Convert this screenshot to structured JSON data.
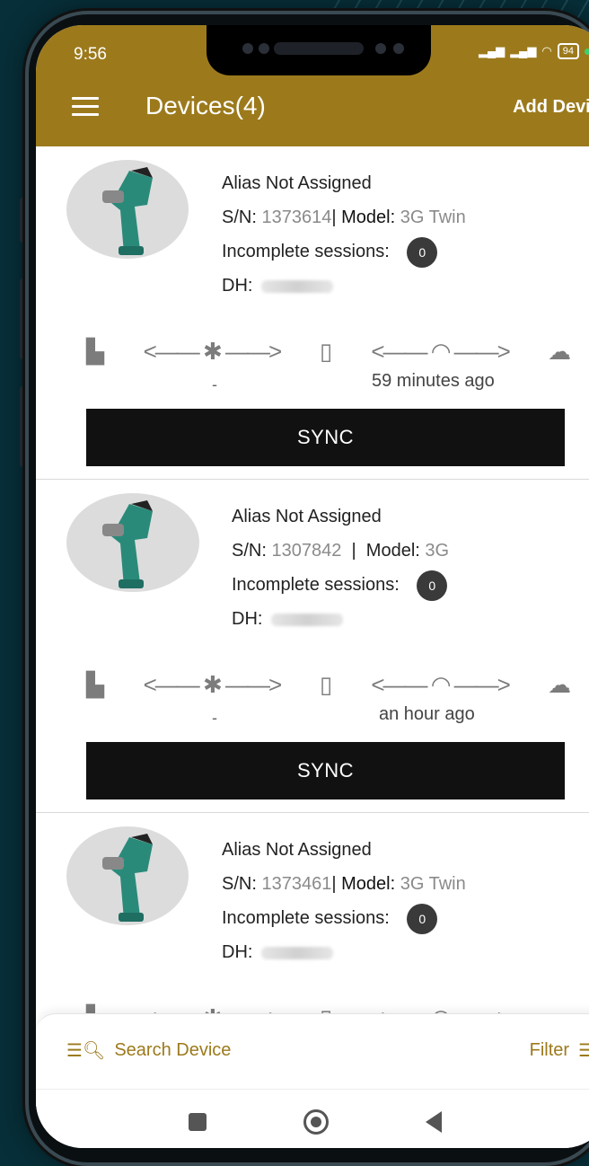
{
  "status_bar": {
    "time": "9:56",
    "battery": "94"
  },
  "header": {
    "title": "Devices(4)",
    "add_device_label": "Add Device"
  },
  "devices": [
    {
      "alias": "Alias Not Assigned",
      "sn_label": "S/N:",
      "sn_value": "1373614",
      "separator": "|",
      "model_label": "Model:",
      "model_value": "3G Twin",
      "sessions_label": "Incomplete sessions:",
      "sessions_count": "0",
      "dh_label": "DH:",
      "tool_to_phone_sync": "-",
      "phone_to_cloud_sync": "59 minutes ago",
      "sync_label": "SYNC"
    },
    {
      "alias": "Alias Not Assigned",
      "sn_label": "S/N:",
      "sn_value": "1307842",
      "separator": "|",
      "model_label": "Model:",
      "model_value": "3G",
      "sessions_label": "Incomplete sessions:",
      "sessions_count": "0",
      "dh_label": "DH:",
      "tool_to_phone_sync": "-",
      "phone_to_cloud_sync": "an hour ago",
      "sync_label": "SYNC"
    },
    {
      "alias": "Alias Not Assigned",
      "sn_label": "S/N:",
      "sn_value": "1373461",
      "separator": "|",
      "model_label": "Model:",
      "model_value": "3G Twin",
      "sessions_label": "Incomplete sessions:",
      "sessions_count": "0",
      "dh_label": "DH:"
    }
  ],
  "bottom_bar": {
    "search_label": "Search Device",
    "filter_label": "Filter"
  },
  "colors": {
    "primary": "#9c7a1c",
    "sync_button": "#111111",
    "background": "#072f39"
  },
  "icons": [
    "menu-icon",
    "tool-icon",
    "bluetooth-icon",
    "phone-icon",
    "wifi-icon",
    "cloud-icon",
    "chevron-right-icon",
    "search-list-icon",
    "filter-icon"
  ]
}
